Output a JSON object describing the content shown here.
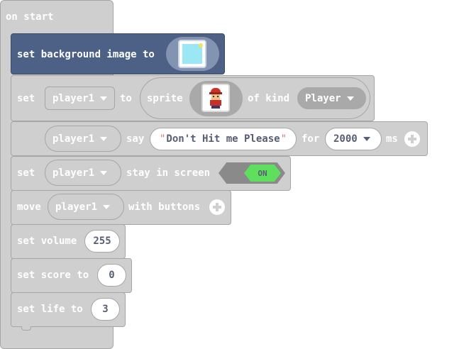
{
  "colors": {
    "block": "#cfcfcf",
    "block_border": "#a6a6a6",
    "background_block": "#4c6185",
    "toggle_on": "#5ee05e",
    "toggle_track": "#8a8a8a",
    "field_text": "#575e75"
  },
  "on_start": {
    "label": "on start"
  },
  "set_background": {
    "label": "set background image to",
    "image_icon": "image-icon"
  },
  "set_sprite": {
    "set_label": "set",
    "variable": "player1",
    "to_label": "to",
    "sprite_label": "sprite",
    "sprite_icon": "red-cap-character-icon",
    "of_kind_label": "of kind",
    "kind": "Player"
  },
  "say": {
    "variable": "player1",
    "say_label": "say",
    "open_quote": "\"",
    "text": "Don't Hit me Please",
    "close_quote": "\"",
    "for_label": "for",
    "duration": "2000",
    "ms_label": "ms"
  },
  "stay_in_screen": {
    "set_label": "set",
    "variable": "player1",
    "label": "stay in screen",
    "toggle": "ON"
  },
  "move": {
    "move_label": "move",
    "variable": "player1",
    "label": "with buttons"
  },
  "volume": {
    "label": "set volume",
    "value": "255"
  },
  "score": {
    "label": "set score to",
    "value": "0"
  },
  "life": {
    "label": "set life to",
    "value": "3"
  }
}
